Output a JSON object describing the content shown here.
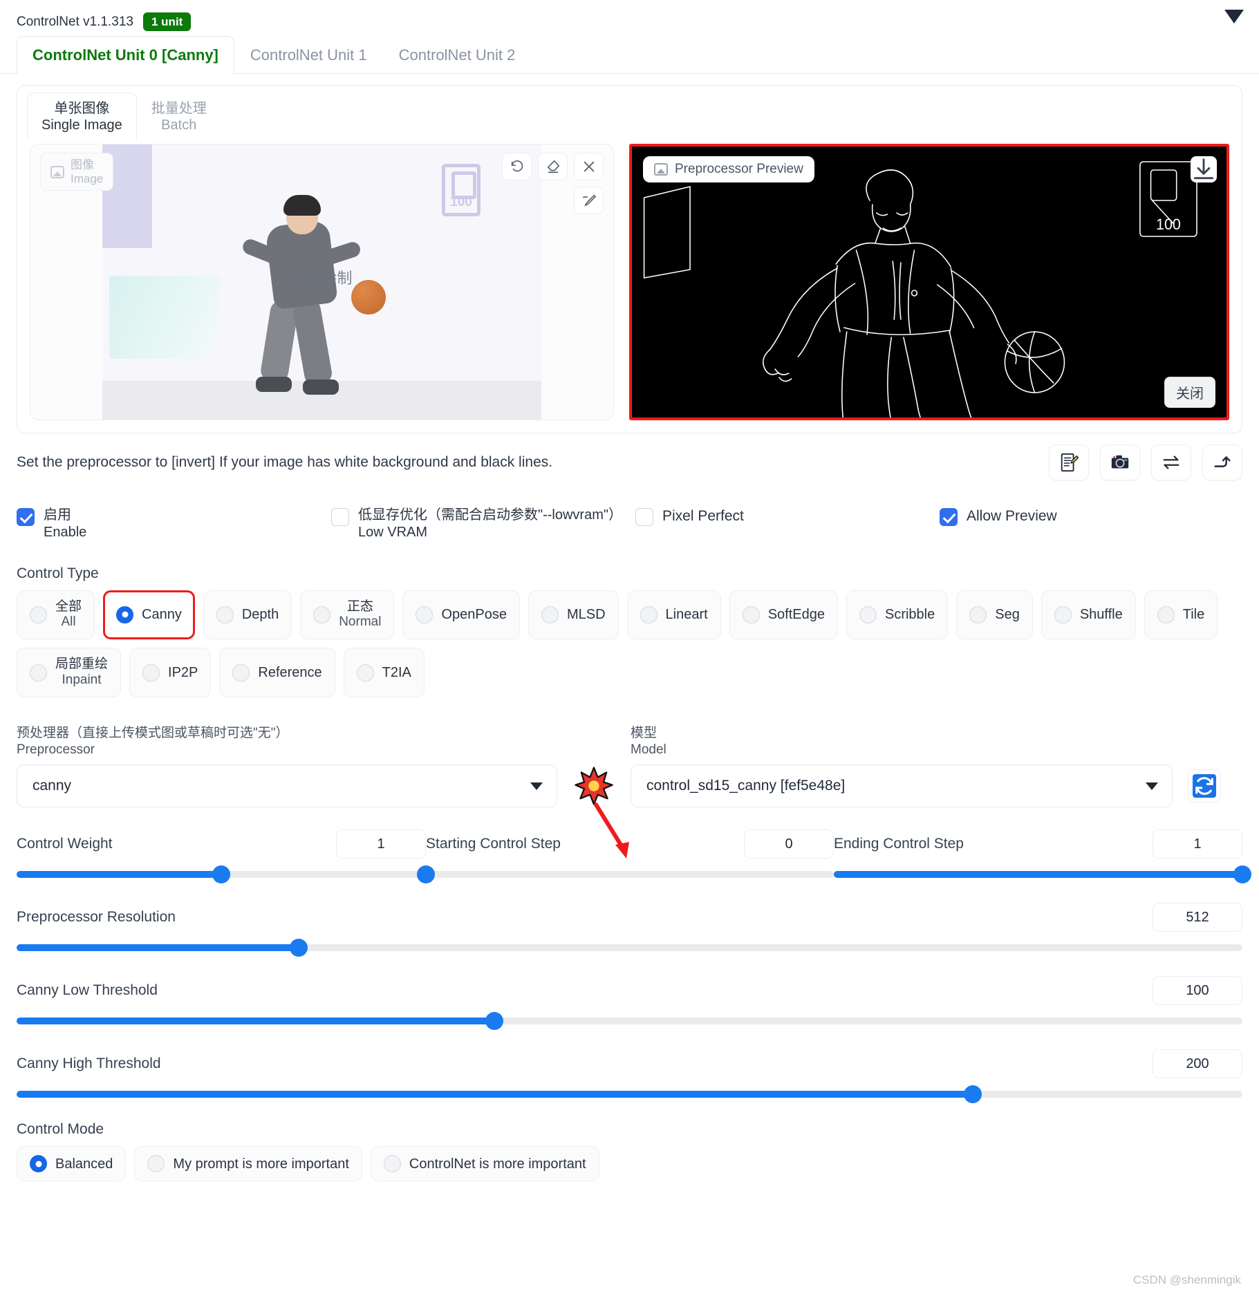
{
  "header": {
    "version": "ControlNet v1.1.313",
    "unit_badge": "1 unit",
    "collapse_icon": "caret-down-icon"
  },
  "unit_tabs": [
    {
      "label": "ControlNet Unit 0 [Canny]",
      "active": true
    },
    {
      "label": "ControlNet Unit 1",
      "active": false
    },
    {
      "label": "ControlNet Unit 2",
      "active": false
    }
  ],
  "image_tabs": [
    {
      "cn": "单张图像",
      "en": "Single Image",
      "active": true
    },
    {
      "cn": "批量处理",
      "en": "Batch",
      "active": false
    }
  ],
  "source_panel": {
    "chip_cn": "图像",
    "chip_en": "Image",
    "chip_icon": "image-icon",
    "overlay_text": "开始绘制",
    "logo_text": "100",
    "tools": [
      {
        "name": "undo-icon"
      },
      {
        "name": "eraser-icon"
      },
      {
        "name": "close-icon"
      },
      {
        "name": "pen-icon"
      }
    ]
  },
  "preview_panel": {
    "title": "Preprocessor Preview",
    "title_icon": "image-icon",
    "download_icon": "download-icon",
    "close_label": "关闭",
    "logo_text": "100",
    "border_color": "#ef1b1b"
  },
  "hint": {
    "text": "Set the preprocessor to [invert] If your image has white background and black lines.",
    "icons": [
      {
        "name": "edit-note-icon"
      },
      {
        "name": "camera-icon"
      },
      {
        "name": "swap-icon"
      },
      {
        "name": "return-arrow-icon"
      }
    ]
  },
  "checkboxes": [
    {
      "cn": "启用",
      "en": "Enable",
      "checked": true
    },
    {
      "cn": "低显存优化（需配合启动参数\"--lowvram\"）",
      "en": "Low VRAM",
      "checked": false
    },
    {
      "label": "Pixel Perfect",
      "checked": false
    },
    {
      "label": "Allow Preview",
      "checked": true
    }
  ],
  "control_type": {
    "title": "Control Type",
    "row1": [
      {
        "cn": "全部",
        "en": "All",
        "selected": false
      },
      {
        "label": "Canny",
        "selected": true,
        "highlight": true
      },
      {
        "label": "Depth",
        "selected": false
      },
      {
        "cn": "正态",
        "en": "Normal",
        "selected": false
      },
      {
        "label": "OpenPose",
        "selected": false
      },
      {
        "label": "MLSD",
        "selected": false
      },
      {
        "label": "Lineart",
        "selected": false
      },
      {
        "label": "SoftEdge",
        "selected": false
      },
      {
        "label": "Scribble",
        "selected": false
      },
      {
        "label": "Seg",
        "selected": false
      },
      {
        "label": "Shuffle",
        "selected": false
      },
      {
        "label": "Tile",
        "selected": false
      }
    ],
    "row2": [
      {
        "cn": "局部重绘",
        "en": "Inpaint",
        "selected": false
      },
      {
        "label": "IP2P",
        "selected": false
      },
      {
        "label": "Reference",
        "selected": false
      },
      {
        "label": "T2IA",
        "selected": false
      }
    ]
  },
  "preprocessor": {
    "label_cn": "预处理器（直接上传模式图或草稿时可选\"无\"）",
    "label_en": "Preprocessor",
    "value": "canny",
    "burst_icon": "burst-icon"
  },
  "model": {
    "label_cn": "模型",
    "label_en": "Model",
    "value": "control_sd15_canny [fef5e48e]",
    "refresh_icon": "refresh-icon"
  },
  "sliders": {
    "control_weight": {
      "label": "Control Weight",
      "value": "1",
      "pct": 50
    },
    "starting_step": {
      "label": "Starting Control Step",
      "value": "0",
      "pct": 0
    },
    "ending_step": {
      "label": "Ending Control Step",
      "value": "1",
      "pct": 100
    },
    "preprocessor_resolution": {
      "label": "Preprocessor Resolution",
      "value": "512",
      "pct": 23
    },
    "canny_low": {
      "label": "Canny Low Threshold",
      "value": "100",
      "pct": 39
    },
    "canny_high": {
      "label": "Canny High Threshold",
      "value": "200",
      "pct": 78
    }
  },
  "control_mode": {
    "title": "Control Mode",
    "options": [
      {
        "label": "Balanced",
        "selected": true
      },
      {
        "label": "My prompt is more important",
        "selected": false
      },
      {
        "label": "ControlNet is more important",
        "selected": false
      }
    ]
  },
  "watermark": "CSDN @shenmingik"
}
